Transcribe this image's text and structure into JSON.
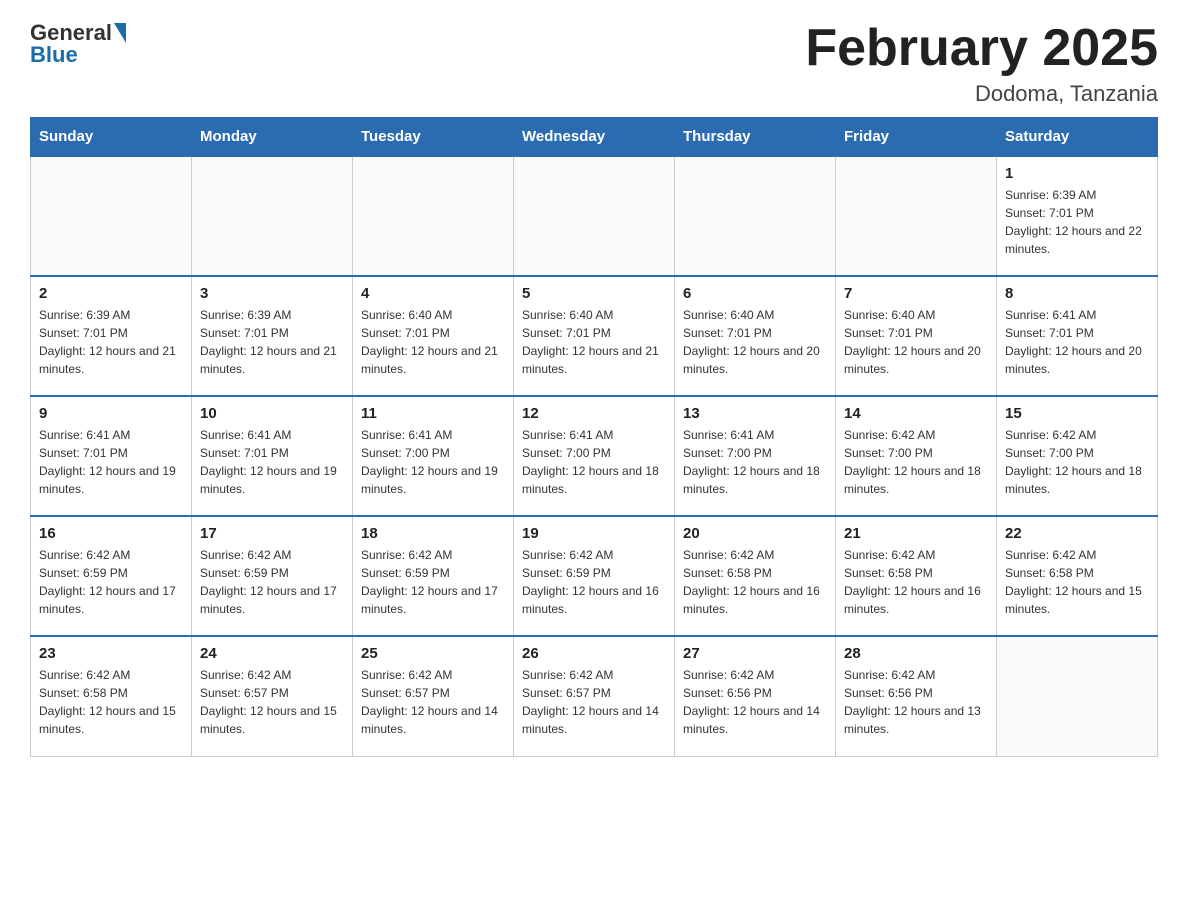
{
  "header": {
    "logo_general": "General",
    "logo_blue": "Blue",
    "month_title": "February 2025",
    "location": "Dodoma, Tanzania"
  },
  "days_of_week": [
    "Sunday",
    "Monday",
    "Tuesday",
    "Wednesday",
    "Thursday",
    "Friday",
    "Saturday"
  ],
  "weeks": [
    [
      {
        "day": "",
        "info": ""
      },
      {
        "day": "",
        "info": ""
      },
      {
        "day": "",
        "info": ""
      },
      {
        "day": "",
        "info": ""
      },
      {
        "day": "",
        "info": ""
      },
      {
        "day": "",
        "info": ""
      },
      {
        "day": "1",
        "info": "Sunrise: 6:39 AM\nSunset: 7:01 PM\nDaylight: 12 hours and 22 minutes."
      }
    ],
    [
      {
        "day": "2",
        "info": "Sunrise: 6:39 AM\nSunset: 7:01 PM\nDaylight: 12 hours and 21 minutes."
      },
      {
        "day": "3",
        "info": "Sunrise: 6:39 AM\nSunset: 7:01 PM\nDaylight: 12 hours and 21 minutes."
      },
      {
        "day": "4",
        "info": "Sunrise: 6:40 AM\nSunset: 7:01 PM\nDaylight: 12 hours and 21 minutes."
      },
      {
        "day": "5",
        "info": "Sunrise: 6:40 AM\nSunset: 7:01 PM\nDaylight: 12 hours and 21 minutes."
      },
      {
        "day": "6",
        "info": "Sunrise: 6:40 AM\nSunset: 7:01 PM\nDaylight: 12 hours and 20 minutes."
      },
      {
        "day": "7",
        "info": "Sunrise: 6:40 AM\nSunset: 7:01 PM\nDaylight: 12 hours and 20 minutes."
      },
      {
        "day": "8",
        "info": "Sunrise: 6:41 AM\nSunset: 7:01 PM\nDaylight: 12 hours and 20 minutes."
      }
    ],
    [
      {
        "day": "9",
        "info": "Sunrise: 6:41 AM\nSunset: 7:01 PM\nDaylight: 12 hours and 19 minutes."
      },
      {
        "day": "10",
        "info": "Sunrise: 6:41 AM\nSunset: 7:01 PM\nDaylight: 12 hours and 19 minutes."
      },
      {
        "day": "11",
        "info": "Sunrise: 6:41 AM\nSunset: 7:00 PM\nDaylight: 12 hours and 19 minutes."
      },
      {
        "day": "12",
        "info": "Sunrise: 6:41 AM\nSunset: 7:00 PM\nDaylight: 12 hours and 18 minutes."
      },
      {
        "day": "13",
        "info": "Sunrise: 6:41 AM\nSunset: 7:00 PM\nDaylight: 12 hours and 18 minutes."
      },
      {
        "day": "14",
        "info": "Sunrise: 6:42 AM\nSunset: 7:00 PM\nDaylight: 12 hours and 18 minutes."
      },
      {
        "day": "15",
        "info": "Sunrise: 6:42 AM\nSunset: 7:00 PM\nDaylight: 12 hours and 18 minutes."
      }
    ],
    [
      {
        "day": "16",
        "info": "Sunrise: 6:42 AM\nSunset: 6:59 PM\nDaylight: 12 hours and 17 minutes."
      },
      {
        "day": "17",
        "info": "Sunrise: 6:42 AM\nSunset: 6:59 PM\nDaylight: 12 hours and 17 minutes."
      },
      {
        "day": "18",
        "info": "Sunrise: 6:42 AM\nSunset: 6:59 PM\nDaylight: 12 hours and 17 minutes."
      },
      {
        "day": "19",
        "info": "Sunrise: 6:42 AM\nSunset: 6:59 PM\nDaylight: 12 hours and 16 minutes."
      },
      {
        "day": "20",
        "info": "Sunrise: 6:42 AM\nSunset: 6:58 PM\nDaylight: 12 hours and 16 minutes."
      },
      {
        "day": "21",
        "info": "Sunrise: 6:42 AM\nSunset: 6:58 PM\nDaylight: 12 hours and 16 minutes."
      },
      {
        "day": "22",
        "info": "Sunrise: 6:42 AM\nSunset: 6:58 PM\nDaylight: 12 hours and 15 minutes."
      }
    ],
    [
      {
        "day": "23",
        "info": "Sunrise: 6:42 AM\nSunset: 6:58 PM\nDaylight: 12 hours and 15 minutes."
      },
      {
        "day": "24",
        "info": "Sunrise: 6:42 AM\nSunset: 6:57 PM\nDaylight: 12 hours and 15 minutes."
      },
      {
        "day": "25",
        "info": "Sunrise: 6:42 AM\nSunset: 6:57 PM\nDaylight: 12 hours and 14 minutes."
      },
      {
        "day": "26",
        "info": "Sunrise: 6:42 AM\nSunset: 6:57 PM\nDaylight: 12 hours and 14 minutes."
      },
      {
        "day": "27",
        "info": "Sunrise: 6:42 AM\nSunset: 6:56 PM\nDaylight: 12 hours and 14 minutes."
      },
      {
        "day": "28",
        "info": "Sunrise: 6:42 AM\nSunset: 6:56 PM\nDaylight: 12 hours and 13 minutes."
      },
      {
        "day": "",
        "info": ""
      }
    ]
  ]
}
